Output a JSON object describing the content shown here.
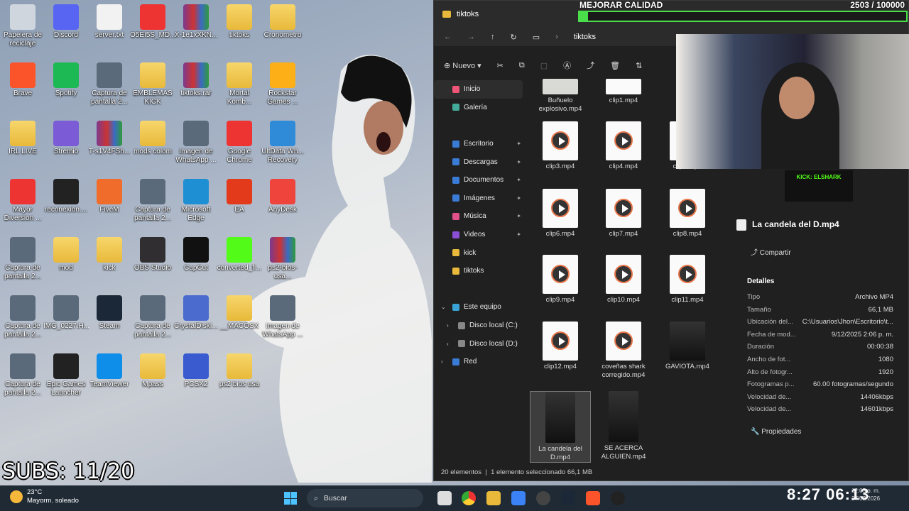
{
  "desktop": {
    "icons": [
      {
        "label": "Papelera de reciclaje",
        "icon": "recycle-bin-icon"
      },
      {
        "label": "Discord",
        "icon": "discord-icon"
      },
      {
        "label": "server.txt",
        "icon": "text-file-icon"
      },
      {
        "label": "O5EI5S_MD...",
        "icon": "chrome-icon"
      },
      {
        "label": "X-1e1xXKN...",
        "icon": "winrar-icon"
      },
      {
        "label": "tiktoks",
        "icon": "folder-icon"
      },
      {
        "label": "Cronometro",
        "icon": "folder-icon"
      },
      {
        "label": "Brave",
        "icon": "brave-icon"
      },
      {
        "label": "Spotify",
        "icon": "spotify-icon"
      },
      {
        "label": "Captura de pantalla 2...",
        "icon": "image-icon"
      },
      {
        "label": "EMBLEMAS KICK",
        "icon": "folder-icon"
      },
      {
        "label": "tiktoks.rar",
        "icon": "winrar-icon"
      },
      {
        "label": "Mortal Komb...",
        "icon": "folder-icon"
      },
      {
        "label": "Rockstar Games ...",
        "icon": "rockstar-icon"
      },
      {
        "label": "IRL LIVE",
        "icon": "folder-icon"
      },
      {
        "label": "Stremio",
        "icon": "stremio-icon"
      },
      {
        "label": "T-s1V4FSh...",
        "icon": "winrar-icon"
      },
      {
        "label": "mods colom",
        "icon": "folder-icon"
      },
      {
        "label": "Imagen de WhatsApp ...",
        "icon": "image-icon"
      },
      {
        "label": "Google Chrome",
        "icon": "chrome-icon"
      },
      {
        "label": "UltData Wh... Recovery",
        "icon": "ultdata-icon"
      },
      {
        "label": "Mayor Diversion ...",
        "icon": "chrome-icon"
      },
      {
        "label": "reconexion....",
        "icon": "video-icon"
      },
      {
        "label": "FiveM",
        "icon": "fivem-icon"
      },
      {
        "label": "Captura de pantalla 2...",
        "icon": "image-icon"
      },
      {
        "label": "Microsoft Edge",
        "icon": "edge-icon"
      },
      {
        "label": "EA",
        "icon": "ea-icon"
      },
      {
        "label": "AnyDesk",
        "icon": "anydesk-icon"
      },
      {
        "label": "Captura de pantalla 2...",
        "icon": "image-icon"
      },
      {
        "label": "mod",
        "icon": "folder-icon"
      },
      {
        "label": "kick",
        "icon": "folder-icon"
      },
      {
        "label": "OBS Studio",
        "icon": "obs-icon"
      },
      {
        "label": "CapCut",
        "icon": "capcut-icon"
      },
      {
        "label": "converted_fi...",
        "icon": "kick-icon"
      },
      {
        "label": "ps2-bios-usa...",
        "icon": "winrar-icon"
      },
      {
        "label": "Captura de pantalla 2...",
        "icon": "image-icon"
      },
      {
        "label": "IMG_0227.H...",
        "icon": "image-icon"
      },
      {
        "label": "Steam",
        "icon": "steam-icon"
      },
      {
        "label": "Captura de pantalla 2...",
        "icon": "image-icon"
      },
      {
        "label": "CrystalDiskI...",
        "icon": "crystaldisk-icon"
      },
      {
        "label": "__MACOSX",
        "icon": "folder-icon"
      },
      {
        "label": "Imagen de WhatsApp ...",
        "icon": "image-icon"
      },
      {
        "label": "Captura de pantalla 2...",
        "icon": "image-icon"
      },
      {
        "label": "Epic Games Launcher",
        "icon": "epic-icon"
      },
      {
        "label": "TeamViewer",
        "icon": "teamviewer-icon"
      },
      {
        "label": "Mpass",
        "icon": "folder-icon"
      },
      {
        "label": "PCSX2",
        "icon": "pcsx2-icon"
      },
      {
        "label": "ps2 bios usa",
        "icon": "folder-icon"
      }
    ],
    "subs": "SUBS: 11/20"
  },
  "explorer": {
    "title": "tiktoks",
    "breadcrumb": "tiktoks",
    "new_label": "Nuevo",
    "sidebar": [
      {
        "label": "Inicio",
        "pinned": false
      },
      {
        "label": "Galería",
        "pinned": false
      },
      {
        "label": "Escritorio",
        "pinned": true
      },
      {
        "label": "Descargas",
        "pinned": true
      },
      {
        "label": "Documentos",
        "pinned": true
      },
      {
        "label": "Imágenes",
        "pinned": true
      },
      {
        "label": "Música",
        "pinned": true
      },
      {
        "label": "Videos",
        "pinned": true
      },
      {
        "label": "kick",
        "pinned": false
      },
      {
        "label": "tiktoks",
        "pinned": false
      },
      {
        "label": "Este equipo",
        "pinned": false
      },
      {
        "label": "Disco local (C:)",
        "pinned": false
      },
      {
        "label": "Disco local (D:)",
        "pinned": false
      },
      {
        "label": "Red",
        "pinned": false
      }
    ],
    "files": [
      {
        "name": "Buñuelo explosivo.mp4"
      },
      {
        "name": "clip1.mp4"
      },
      {
        "name": "clip3.mp4"
      },
      {
        "name": "clip4.mp4"
      },
      {
        "name": "clip5.mp4"
      },
      {
        "name": "clip6.mp4"
      },
      {
        "name": "clip7.mp4"
      },
      {
        "name": "clip8.mp4"
      },
      {
        "name": "clip9.mp4"
      },
      {
        "name": "clip10.mp4"
      },
      {
        "name": "clip11.mp4"
      },
      {
        "name": "clip12.mp4"
      },
      {
        "name": "coveñas shark corregido.mp4"
      },
      {
        "name": "GAVIOTA.mp4"
      },
      {
        "name": "La candela del D.mp4"
      },
      {
        "name": "SE ACERCA ALGUIEN.mp4"
      }
    ],
    "status": {
      "count": "20 elementos",
      "selected": "1 elemento seleccionado  66,1 MB"
    },
    "details": {
      "filename": "La candela del D.mp4",
      "share_label": "Compartir",
      "section_title": "Detalles",
      "rows": [
        {
          "key": "Tipo",
          "value": "Archivo MP4"
        },
        {
          "key": "Tamaño",
          "value": "66,1 MB"
        },
        {
          "key": "Ubicación del...",
          "value": "C:\\Usuarios\\Jhon\\Escritorio\\t..."
        },
        {
          "key": "Fecha de mod...",
          "value": "9/12/2025 2:06 p. m."
        },
        {
          "key": "Duración",
          "value": "00:00:38"
        },
        {
          "key": "Ancho de fot...",
          "value": "1080"
        },
        {
          "key": "Alto de fotogr...",
          "value": "1920"
        },
        {
          "key": "Fotogramas p...",
          "value": "60.00 fotogramas/segundo"
        },
        {
          "key": "Velocidad de...",
          "value": "14406kbps"
        },
        {
          "key": "Velocidad de...",
          "value": "14601kbps"
        }
      ],
      "properties_label": "Propiedades"
    }
  },
  "overlay": {
    "goal_title": "MEJORAR CALIDAD",
    "goal_count": "2503  / 100000",
    "goal_fraction": 0.025,
    "kick_label": "KICK: ELSHARK",
    "clock": "8:27 06:13"
  },
  "taskbar": {
    "temp": "23°C",
    "weather": "Mayorm. soleado",
    "search_placeholder": "Buscar",
    "time": "12:05 p. m.",
    "date": "27/02/2026",
    "colors": {
      "start": "#4cc2ff",
      "goal": "#4ade4a",
      "kick": "#53fc18"
    }
  }
}
